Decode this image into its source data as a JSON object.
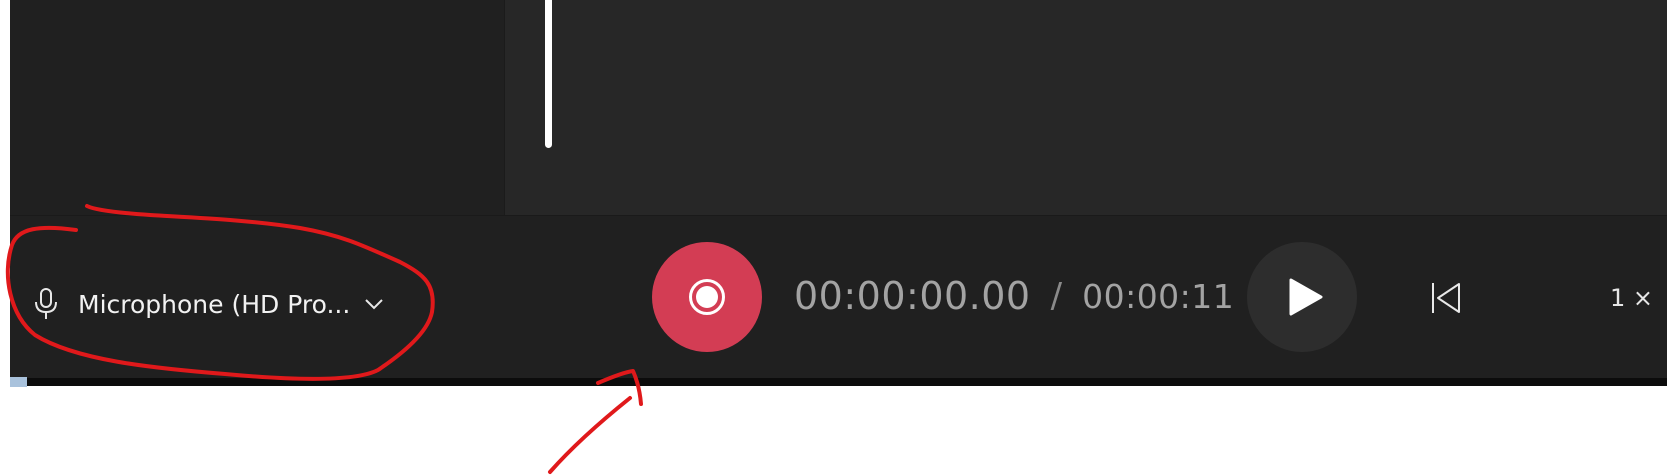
{
  "microphone": {
    "label": "Microphone (HD Pro...",
    "icon": "microphone-icon",
    "dropdown_icon": "chevron-down-icon"
  },
  "transport": {
    "record_icon": "record-icon",
    "current_time": "00:00:00.00",
    "separator": "/",
    "total_time": "00:00:11",
    "play_icon": "play-icon",
    "skip_icon": "skip-to-start-icon",
    "speed_label": "1 ×"
  },
  "colors": {
    "record": "#d33d54",
    "background": "#202020",
    "annotation": "#e0191b"
  }
}
